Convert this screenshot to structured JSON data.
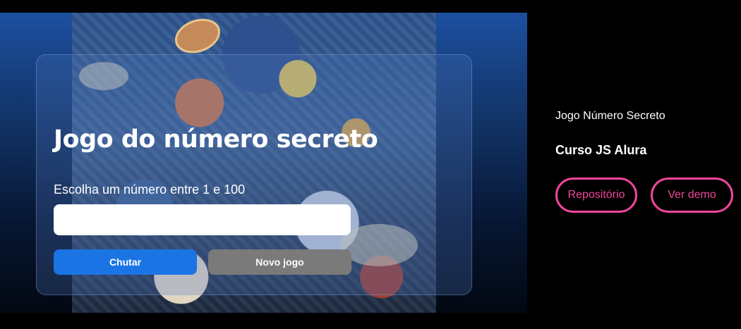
{
  "game": {
    "title": "Jogo do número secreto",
    "prompt": "Escolha um número entre 1 e 100",
    "input_value": "",
    "guess_button": "Chutar",
    "new_game_button": "Novo jogo",
    "colors": {
      "guess": "#1b74e4",
      "new_game": "#7a7a7a"
    }
  },
  "project": {
    "title": "Jogo Número Secreto",
    "course": "Curso JS Alura",
    "repo_button": "Repositório",
    "demo_button": "Ver demo",
    "accent": "#f0469b"
  }
}
